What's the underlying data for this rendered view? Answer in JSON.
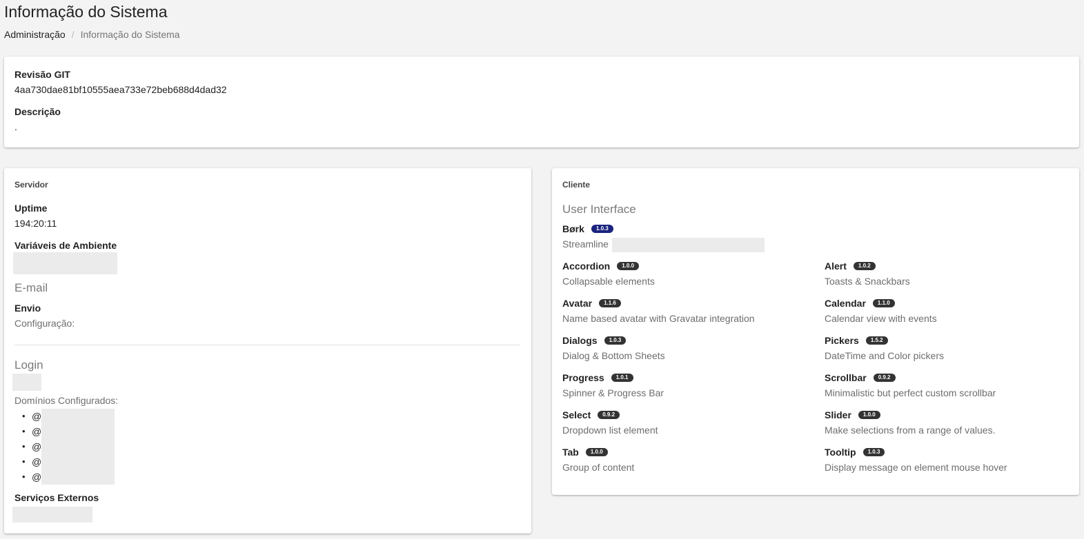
{
  "page": {
    "title": "Informação do Sistema",
    "breadcrumb": {
      "parent": "Administração",
      "separator": "/",
      "current": "Informação do Sistema"
    }
  },
  "info": {
    "git_label": "Revisão GIT",
    "git_value": "4aa730dae81bf10555aea733e72beb688d4dad32",
    "desc_label": "Descrição",
    "desc_value": "."
  },
  "server": {
    "heading": "Servidor",
    "uptime_label": "Uptime",
    "uptime_value": "194:20:11",
    "env_label": "Variáveis de Ambiente",
    "email_title": "E-mail",
    "send_label": "Envio",
    "config_label": "Configuração:",
    "login_title": "Login",
    "domains_label": "Domínios Configurados:",
    "domains": [
      "@",
      "@",
      "@",
      "@",
      "@"
    ],
    "external_label": "Serviços Externos"
  },
  "client": {
    "heading": "Cliente",
    "ui_title": "User Interface",
    "bork": {
      "name": "Børk",
      "version": "1.0.3",
      "desc": "Streamline"
    },
    "components_left": [
      {
        "name": "Accordion",
        "version": "1.0.0",
        "desc": "Collapsable elements"
      },
      {
        "name": "Avatar",
        "version": "1.1.6",
        "desc": "Name based avatar with Gravatar integration"
      },
      {
        "name": "Dialogs",
        "version": "1.0.3",
        "desc": "Dialog & Bottom Sheets"
      },
      {
        "name": "Progress",
        "version": "1.0.1",
        "desc": "Spinner & Progress Bar"
      },
      {
        "name": "Select",
        "version": "0.9.2",
        "desc": "Dropdown list element"
      },
      {
        "name": "Tab",
        "version": "1.0.0",
        "desc": "Group of content"
      }
    ],
    "components_right": [
      {
        "name": "Alert",
        "version": "1.0.2",
        "desc": "Toasts & Snackbars"
      },
      {
        "name": "Calendar",
        "version": "1.1.0",
        "desc": "Calendar view with events"
      },
      {
        "name": "Pickers",
        "version": "1.5.2",
        "desc": "DateTime and Color pickers"
      },
      {
        "name": "Scrollbar",
        "version": "0.9.2",
        "desc": "Minimalistic but perfect custom scrollbar"
      },
      {
        "name": "Slider",
        "version": "1.0.0",
        "desc": "Make selections from a range of values."
      },
      {
        "name": "Tooltip",
        "version": "1.0.3",
        "desc": "Display message on element mouse hover"
      }
    ]
  }
}
